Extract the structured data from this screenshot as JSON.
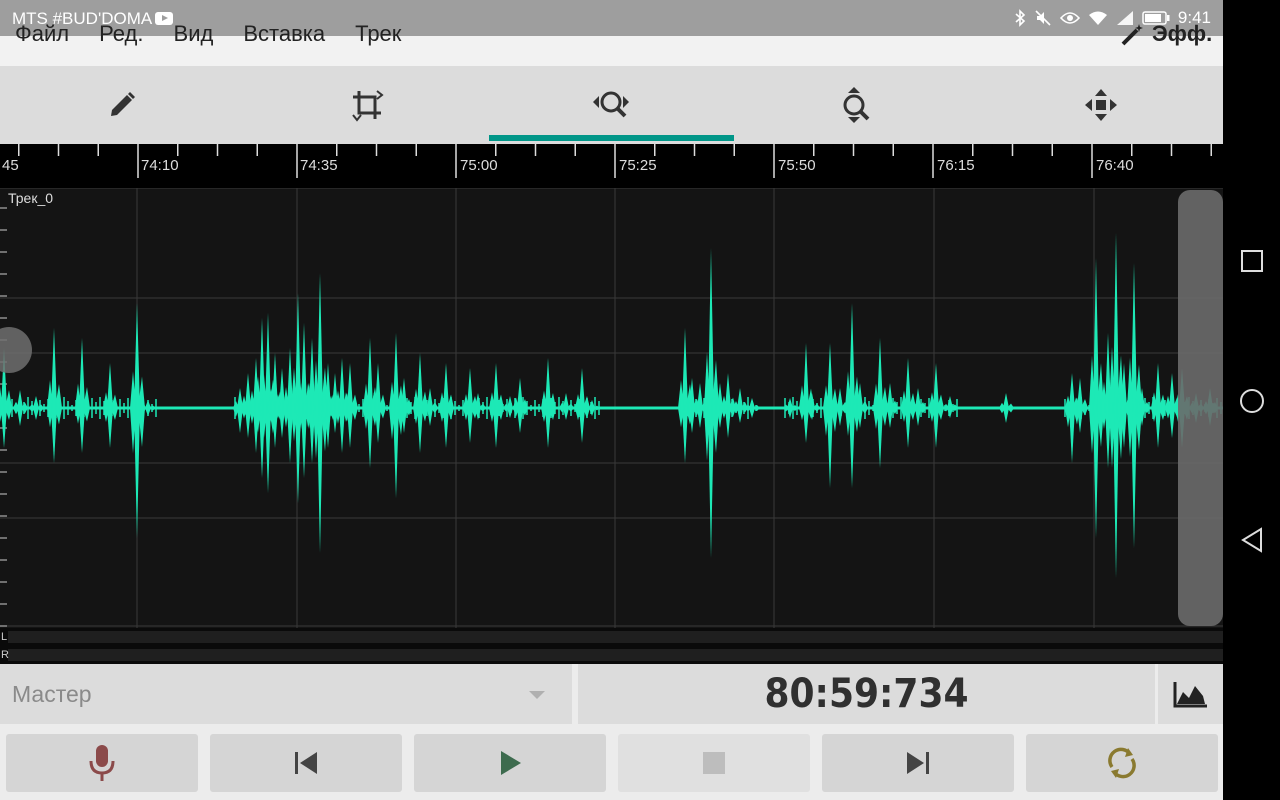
{
  "status_bar": {
    "carrier": "MTS #BUD'DOMA",
    "time": "9:41"
  },
  "menu": {
    "items": [
      "Файл",
      "Ред.",
      "Вид",
      "Вставка",
      "Трек"
    ],
    "effects_label": "Эфф."
  },
  "toolbar": {
    "tools": [
      {
        "name": "pencil-icon"
      },
      {
        "name": "crop-icon"
      },
      {
        "name": "zoom-horizontal-icon",
        "active": true
      },
      {
        "name": "zoom-vertical-icon"
      },
      {
        "name": "move-icon"
      }
    ],
    "accent_color": "#009688"
  },
  "timeline": {
    "labels": [
      "45",
      "74:10",
      "74:35",
      "75:00",
      "75:25",
      "75:50",
      "76:15",
      "76:40"
    ]
  },
  "track": {
    "name": "Трек_0",
    "wave_color": "#1de9b6",
    "channel_labels": [
      "L",
      "R"
    ]
  },
  "bottom": {
    "master_label": "Мастер",
    "timer": "80:59:734"
  },
  "transport": {
    "buttons": [
      "record-button",
      "skip-back-button",
      "play-button",
      "stop-button",
      "skip-forward-button",
      "loop-button"
    ]
  }
}
